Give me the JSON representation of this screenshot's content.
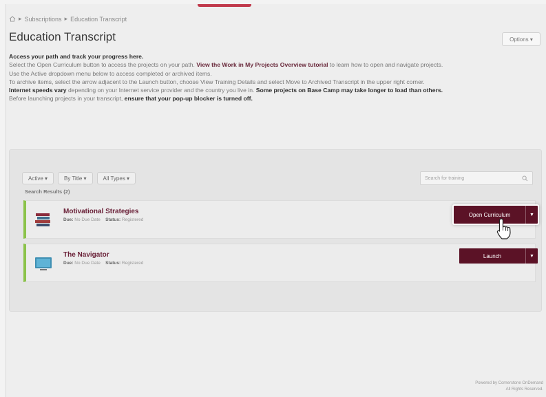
{
  "breadcrumb": {
    "home_icon": "home-icon",
    "items": [
      "Subscriptions",
      "Education Transcript"
    ]
  },
  "page": {
    "title": "Education Transcript",
    "options_label": "Options ▾"
  },
  "intro": {
    "heading": "Access your path and track your progress here.",
    "line1_pre": "Select the Open Curriculum button to access the projects on your path.",
    "line1_link": "View the Work in My Projects Overview tutorial",
    "line1_post": "to learn how to open and navigate projects.",
    "line2": "Use the Active dropdown menu below to access completed or archived items.",
    "line3": "To archive items, select the arrow adjacent to the Launch button, choose View Training Details and select Move to Archived Transcript in the upper right corner.",
    "line4_bold1": "Internet speeds vary",
    "line4_mid": "depending on your Internet service provider and the country you live in.",
    "line4_bold2": "Some projects on Base Camp may take longer to load than others.",
    "line5_pre": "Before launching projects in your transcript,",
    "line5_bold": "ensure that your pop-up blocker is turned off."
  },
  "filters": {
    "status": "Active ▾",
    "sort": "By Title ▾",
    "types": "All Types ▾",
    "search_placeholder": "Search for training",
    "results_label": "Search Results (2)"
  },
  "results": [
    {
      "title": "Motivational Strategies",
      "due_label": "Due:",
      "due_value": "No Due Date",
      "status_label": "Status:",
      "status_value": "Registered",
      "action": "Open Curriculum"
    },
    {
      "title": "The Navigator",
      "due_label": "Due:",
      "due_value": "No Due Date",
      "status_label": "Status:",
      "status_value": "Registered",
      "action": "Launch"
    }
  ],
  "footer": {
    "line1": "Powered by Cornerstone OnDemand",
    "line2": "All Rights Reserved."
  },
  "colors": {
    "brand": "#5b1226",
    "title_link": "#6a2138",
    "accent_bar": "#8bc34a",
    "top_accent": "#c0394b"
  }
}
